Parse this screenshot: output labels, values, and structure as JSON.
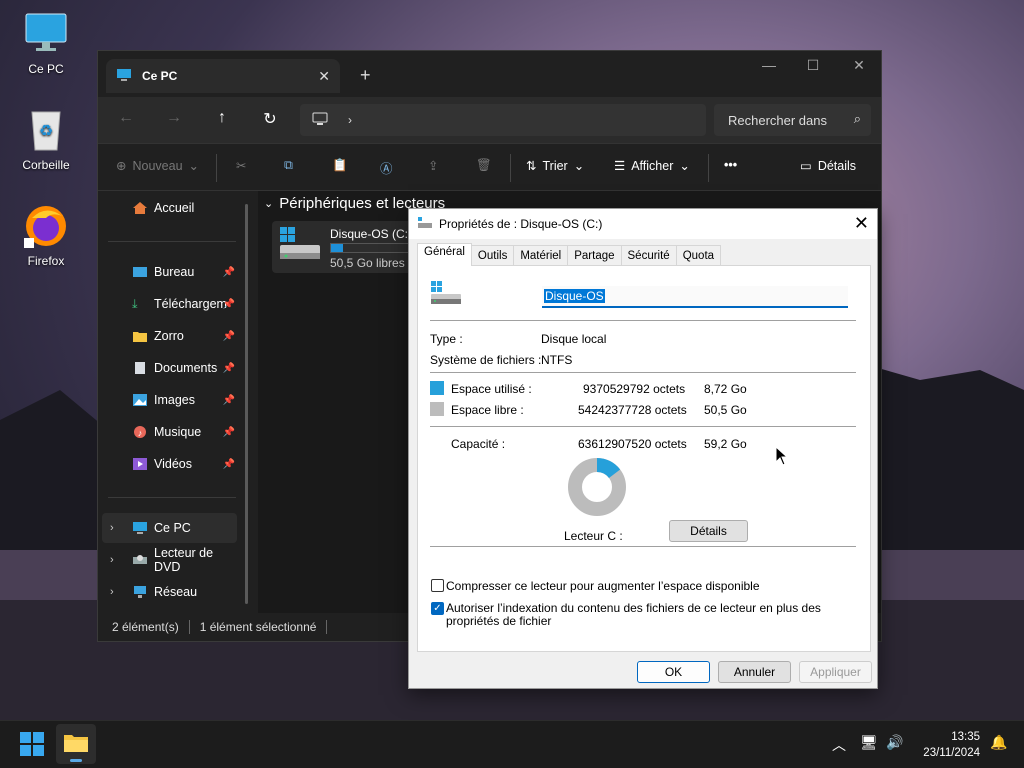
{
  "desktop": {
    "icons": [
      {
        "label": "Ce PC"
      },
      {
        "label": "Corbeille"
      },
      {
        "label": "Firefox"
      }
    ]
  },
  "explorer": {
    "tab_title": "Ce PC",
    "search_placeholder": "Rechercher dans",
    "toolbar": {
      "new_label": "Nouveau",
      "sort_label": "Trier",
      "view_label": "Afficher",
      "more_label": "•••",
      "details_label": "Détails"
    },
    "sidebar": {
      "home": "Accueil",
      "pinned": [
        {
          "label": "Bureau"
        },
        {
          "label": "Téléchargem"
        },
        {
          "label": "Zorro"
        },
        {
          "label": "Documents"
        },
        {
          "label": "Images"
        },
        {
          "label": "Musique"
        },
        {
          "label": "Vidéos"
        }
      ],
      "locations": [
        {
          "label": "Ce PC"
        },
        {
          "label": "Lecteur de DVD"
        },
        {
          "label": "Réseau"
        }
      ]
    },
    "content": {
      "group_header": "Périphériques et lecteurs",
      "drive": {
        "name": "Disque-OS (C:)",
        "free_text": "50,5 Go libres s",
        "used_fraction": 0.15
      }
    },
    "status": {
      "count": "2 élément(s)",
      "selected": "1 élément sélectionné"
    }
  },
  "dialog": {
    "title": "Propriétés de : Disque-OS (C:)",
    "tabs": [
      "Général",
      "Outils",
      "Matériel",
      "Partage",
      "Sécurité",
      "Quota"
    ],
    "active_tab": "Général",
    "name_value": "Disque-OS",
    "type_label": "Type :",
    "type_value": "Disque local",
    "fs_label": "Système de fichiers :",
    "fs_value": "NTFS",
    "used_label": "Espace utilisé :",
    "used_bytes": "9370529792 octets",
    "used_size": "8,72 Go",
    "free_label": "Espace libre :",
    "free_bytes": "54242377728 octets",
    "free_size": "50,5 Go",
    "capacity_label": "Capacité :",
    "capacity_bytes": "63612907520 octets",
    "capacity_size": "59,2 Go",
    "drive_label": "Lecteur C :",
    "details_button": "Détails",
    "used_fraction": 0.147,
    "compress_label": "Compresser ce lecteur pour augmenter l’espace disponible",
    "compress_checked": false,
    "index_label": "Autoriser l’indexation du contenu des fichiers de ce lecteur en plus des propriétés de fichier",
    "index_checked": true,
    "ok_button": "OK",
    "cancel_button": "Annuler",
    "apply_button": "Appliquer",
    "colors": {
      "used": "#26a0da",
      "free": "#bcbcbc"
    }
  },
  "taskbar": {
    "time": "13:35",
    "date": "23/11/2024"
  }
}
